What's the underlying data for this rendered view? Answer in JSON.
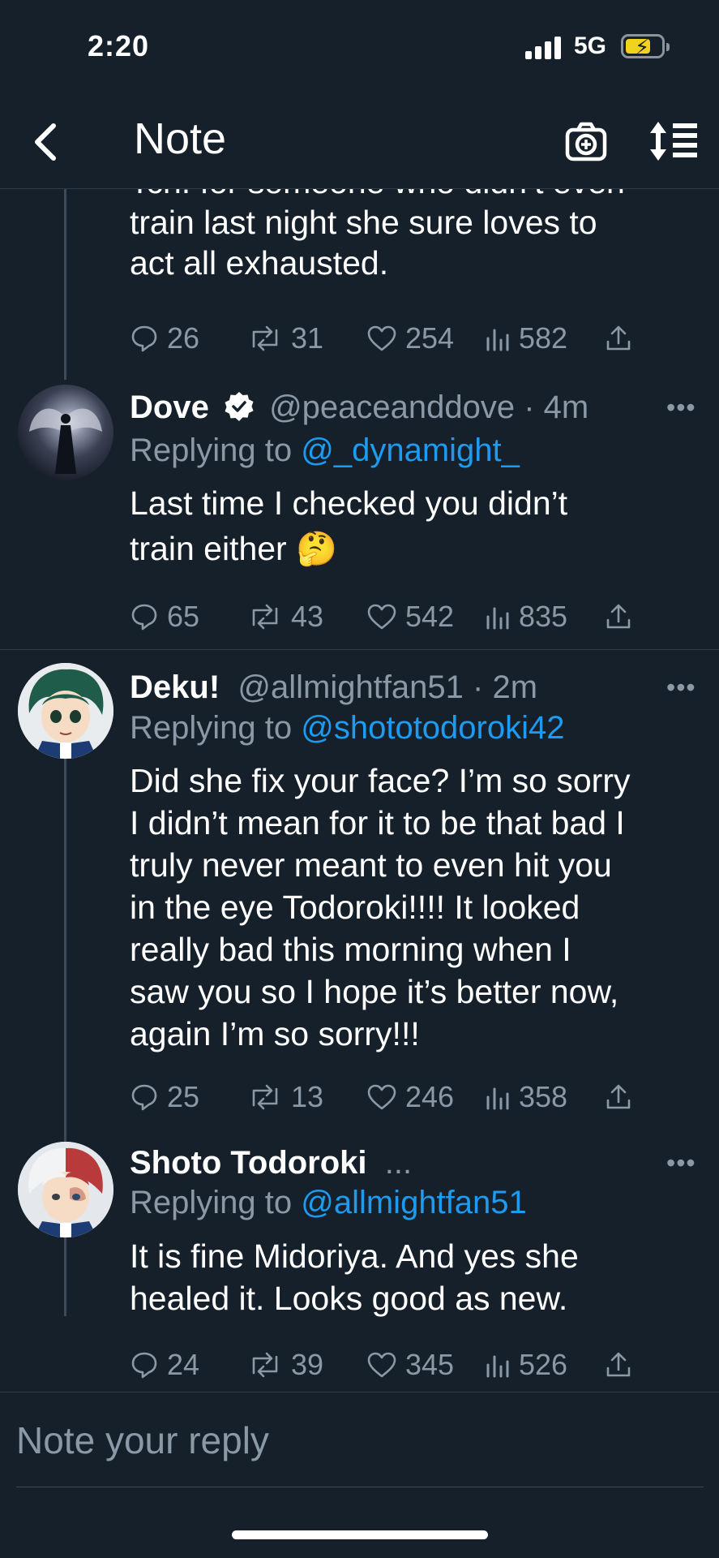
{
  "status": {
    "time": "2:20",
    "network": "5G"
  },
  "header": {
    "title": "Note"
  },
  "prev_tweet": {
    "text_line1": "Tch. for someone who didn’t even",
    "text_line2": "train last night she sure loves to",
    "text_line3": "act all exhausted.",
    "replies": "26",
    "retweets": "31",
    "likes": "254",
    "views": "582"
  },
  "tweets": [
    {
      "name": "Dove",
      "handle": "@peaceanddove · 4m",
      "verified": true,
      "reply_prefix": "Replying to ",
      "reply_to": "@_dynamight_",
      "lines": [
        "Last time I checked you didn’t",
        "train either 🤔"
      ],
      "replies": "65",
      "retweets": "43",
      "likes": "542",
      "views": "835"
    },
    {
      "name": "Deku!",
      "handle": "@allmightfan51 · 2m",
      "reply_prefix": "Replying to ",
      "reply_to": "@shototodoroki42",
      "lines": [
        "Did she fix your face? I’m so sorry",
        "I didn’t mean for it to be that bad I",
        "truly never meant to even hit you",
        "in the eye Todoroki!!!! It looked",
        "really bad this morning when I",
        "saw you so I hope it’s better now,",
        "again I’m so sorry!!!"
      ],
      "replies": "25",
      "retweets": "13",
      "likes": "246",
      "views": "358"
    },
    {
      "name": "Shoto Todoroki",
      "handle": "...",
      "reply_prefix": "Replying to ",
      "reply_to": "@allmightfan51",
      "lines": [
        "It is fine Midoriya. And yes she",
        "healed it. Looks good as new."
      ],
      "replies": "24",
      "retweets": "39",
      "likes": "345",
      "views": "526"
    }
  ],
  "composer": {
    "placeholder": "Note your reply"
  },
  "more_label": "•••",
  "colors": {
    "background": "#15202b",
    "accent": "#1d9bf0",
    "muted": "#8b98a5",
    "battery": "#f2d31b"
  },
  "icons": [
    "back-chevron-icon",
    "camera-add-icon",
    "sort-icon",
    "reply-icon",
    "retweet-icon",
    "like-icon",
    "views-icon",
    "share-icon",
    "verified-icon"
  ]
}
